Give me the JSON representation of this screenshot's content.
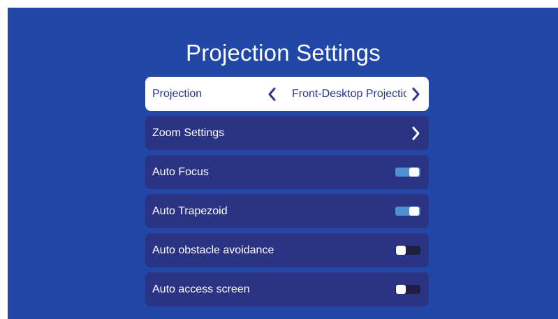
{
  "page": {
    "title": "Projection Settings"
  },
  "menu": {
    "projection": {
      "label": "Projection",
      "value": "Front-Desktop Projection"
    },
    "zoom": {
      "label": "Zoom Settings"
    },
    "auto_focus": {
      "label": "Auto Focus",
      "enabled": true
    },
    "auto_trapezoid": {
      "label": "Auto Trapezoid",
      "enabled": true
    },
    "auto_obstacle": {
      "label": "Auto obstacle avoidance",
      "enabled": false
    },
    "auto_access": {
      "label": "Auto access screen",
      "enabled": false
    }
  },
  "colors": {
    "background": "#2148a6",
    "row": "#2b3385",
    "selected_row": "#ffffff",
    "selected_text": "#2b3290",
    "toggle_on": "#4f8fd2",
    "toggle_off": "#1d2040"
  },
  "icons": {
    "left": "chevron-left-icon",
    "right": "chevron-right-icon"
  }
}
